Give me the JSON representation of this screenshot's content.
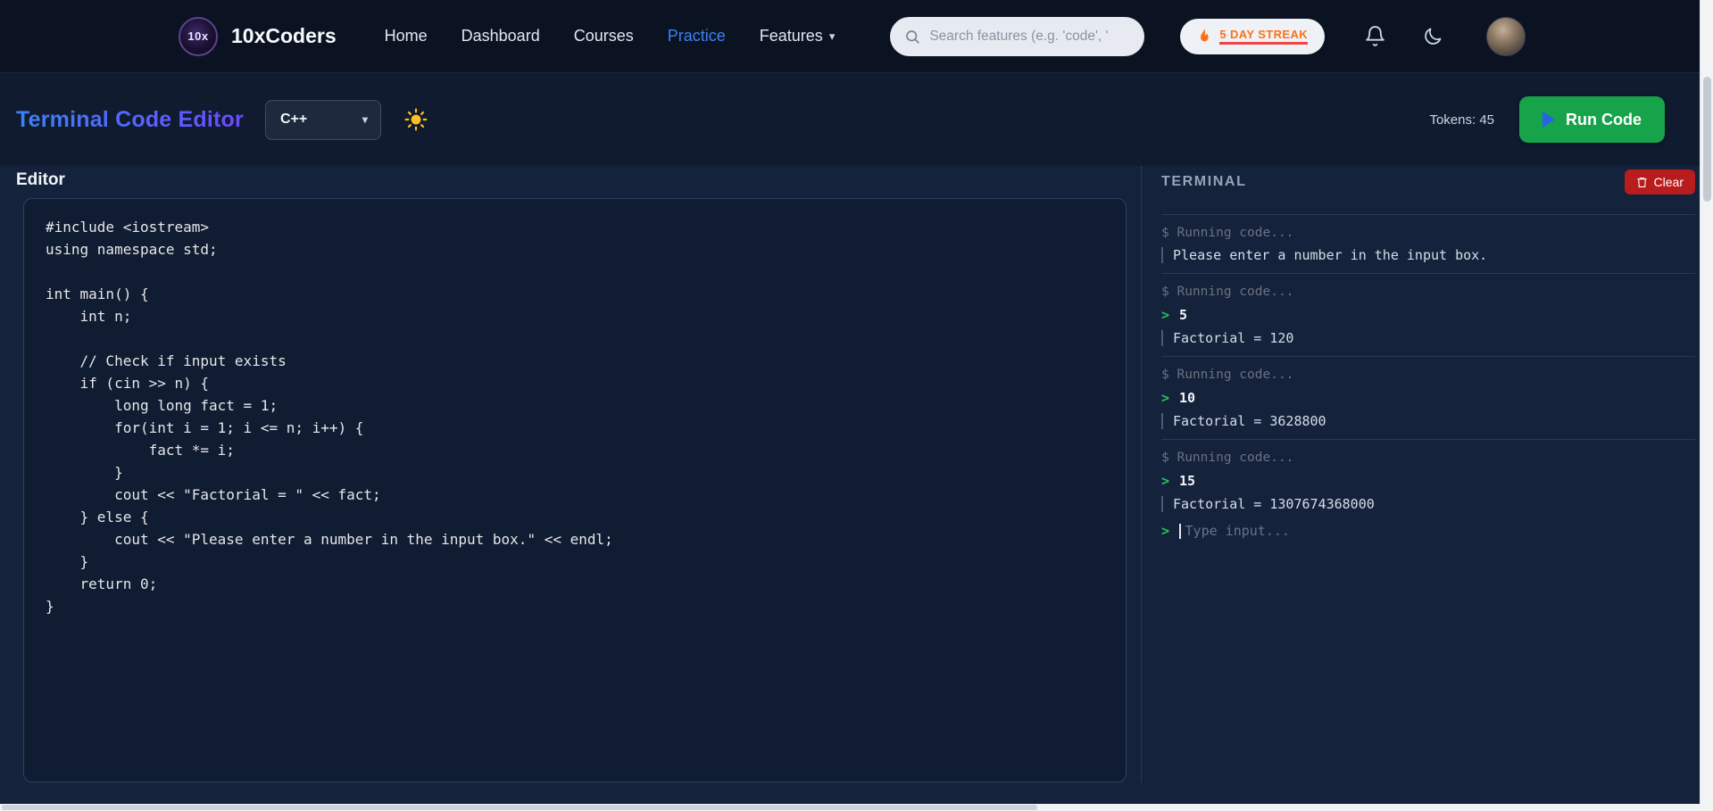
{
  "nav": {
    "logo_text": "10x",
    "brand": "10xCoders",
    "items": [
      {
        "label": "Home",
        "active": false
      },
      {
        "label": "Dashboard",
        "active": false
      },
      {
        "label": "Courses",
        "active": false
      },
      {
        "label": "Practice",
        "active": true
      },
      {
        "label": "Features",
        "active": false,
        "has_dropdown": true
      }
    ],
    "search_placeholder": "Search features (e.g. 'code', '",
    "streak_label": "5 DAY STREAK"
  },
  "toolbar": {
    "title": "Terminal Code Editor",
    "language_selected": "C++",
    "tokens_label": "Tokens: 45",
    "run_button": "Run Code"
  },
  "editor": {
    "label": "Editor",
    "code": "#include <iostream>\nusing namespace std;\n\nint main() {\n    int n;\n\n    // Check if input exists\n    if (cin >> n) {\n        long long fact = 1;\n        for(int i = 1; i <= n; i++) {\n            fact *= i;\n        }\n        cout << \"Factorial = \" << fact;\n    } else {\n        cout << \"Please enter a number in the input box.\" << endl;\n    }\n    return 0;\n}"
  },
  "terminal": {
    "title": "TERMINAL",
    "clear_label": "Clear",
    "prompt_char": ">",
    "input_placeholder": "Type input...",
    "entries": [
      {
        "status": "$ Running code...",
        "input": null,
        "output": "Please enter a number in the input box."
      },
      {
        "status": "$ Running code...",
        "input": "5",
        "output": "Factorial = 120"
      },
      {
        "status": "$ Running code...",
        "input": "10",
        "output": "Factorial = 3628800"
      },
      {
        "status": "$ Running code...",
        "input": "15",
        "output": "Factorial = 1307674368000"
      }
    ]
  },
  "icons": {
    "search": "magnifier",
    "flame": "flame",
    "bell": "bell",
    "moon": "crescent-moon",
    "sun": "sun",
    "chevron_down": "▾",
    "play": "triangle-right",
    "trash": "trash-can"
  },
  "colors": {
    "nav_bg": "#0b1322",
    "page_bg": "#15223c",
    "accent_blue": "#3b82f6",
    "run_green": "#16a34a",
    "clear_red": "#b91c1c",
    "prompt_green": "#22c55e",
    "streak_orange": "#f97316"
  }
}
